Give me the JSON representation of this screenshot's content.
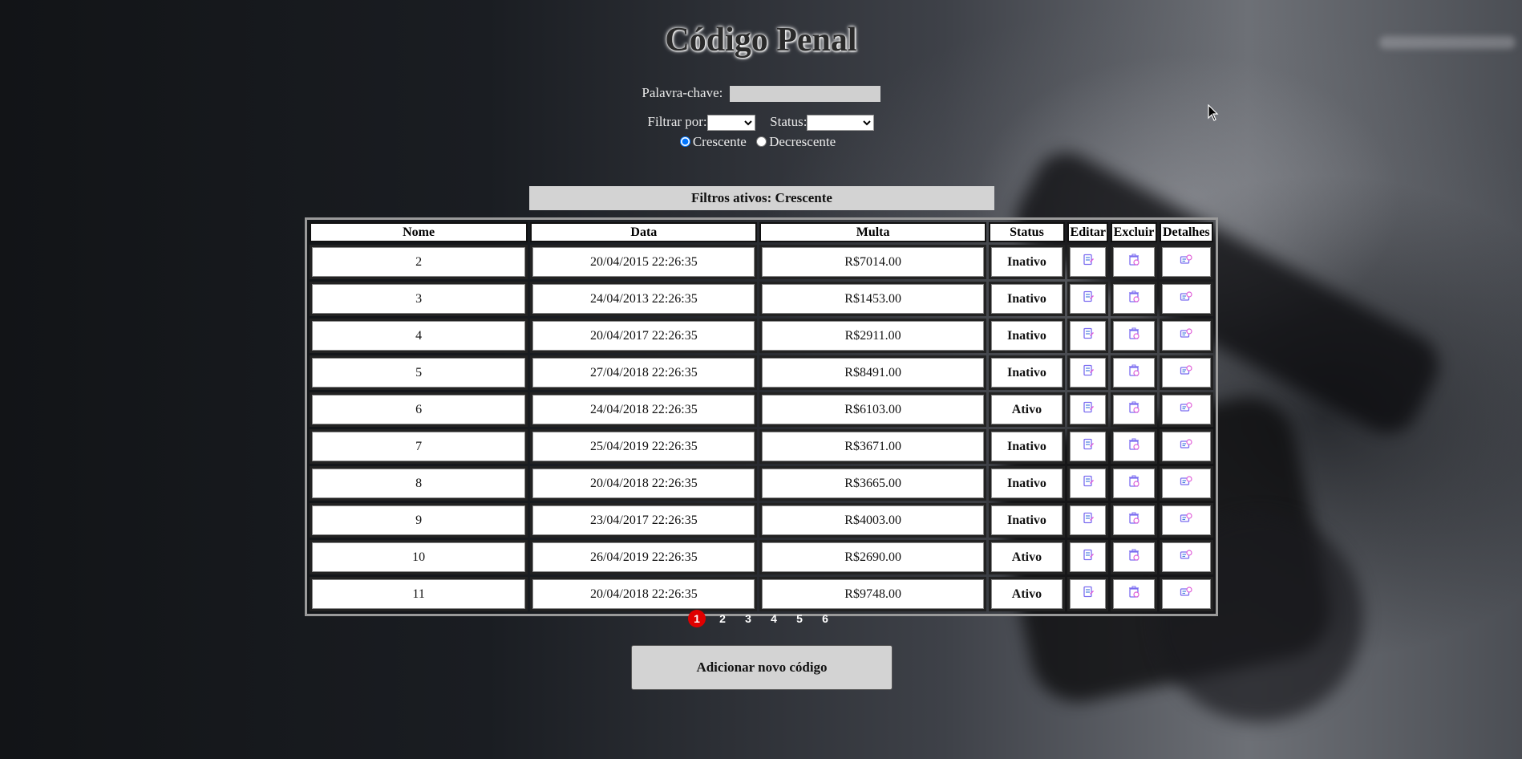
{
  "page": {
    "title": "Código Penal"
  },
  "search": {
    "keyword_label": "Palavra-chave:",
    "keyword_value": "",
    "filter_label": "Filtrar por:",
    "filter_value": "",
    "status_label": "Status:",
    "status_value": ""
  },
  "sort": {
    "asc_label": "Crescente",
    "desc_label": "Decrescente",
    "selected": "asc"
  },
  "active_filters": "Filtros ativos: Crescente",
  "table": {
    "headers": {
      "nome": "Nome",
      "data": "Data",
      "multa": "Multa",
      "status": "Status",
      "editar": "Editar",
      "excluir": "Excluir",
      "detalhes": "Detalhes"
    },
    "rows": [
      {
        "nome": "2",
        "data": "20/04/2015 22:26:35",
        "multa": "R$7014.00",
        "status": "Inativo"
      },
      {
        "nome": "3",
        "data": "24/04/2013 22:26:35",
        "multa": "R$1453.00",
        "status": "Inativo"
      },
      {
        "nome": "4",
        "data": "20/04/2017 22:26:35",
        "multa": "R$2911.00",
        "status": "Inativo"
      },
      {
        "nome": "5",
        "data": "27/04/2018 22:26:35",
        "multa": "R$8491.00",
        "status": "Inativo"
      },
      {
        "nome": "6",
        "data": "24/04/2018 22:26:35",
        "multa": "R$6103.00",
        "status": "Ativo"
      },
      {
        "nome": "7",
        "data": "25/04/2019 22:26:35",
        "multa": "R$3671.00",
        "status": "Inativo"
      },
      {
        "nome": "8",
        "data": "20/04/2018 22:26:35",
        "multa": "R$3665.00",
        "status": "Inativo"
      },
      {
        "nome": "9",
        "data": "23/04/2017 22:26:35",
        "multa": "R$4003.00",
        "status": "Inativo"
      },
      {
        "nome": "10",
        "data": "26/04/2019 22:26:35",
        "multa": "R$2690.00",
        "status": "Ativo"
      },
      {
        "nome": "11",
        "data": "20/04/2018 22:26:35",
        "multa": "R$9748.00",
        "status": "Ativo"
      }
    ],
    "icons": {
      "edit": "edit-document-icon",
      "delete": "delete-trash-icon",
      "details": "details-card-icon"
    }
  },
  "pagination": {
    "pages": [
      "1",
      "2",
      "3",
      "4",
      "5",
      "6"
    ],
    "current": "1"
  },
  "add_button": "Adicionar novo código",
  "colors": {
    "inactive": "#e00000",
    "active": "#14331a",
    "current_page": "#e00000",
    "icon": "#7b6cf0"
  }
}
